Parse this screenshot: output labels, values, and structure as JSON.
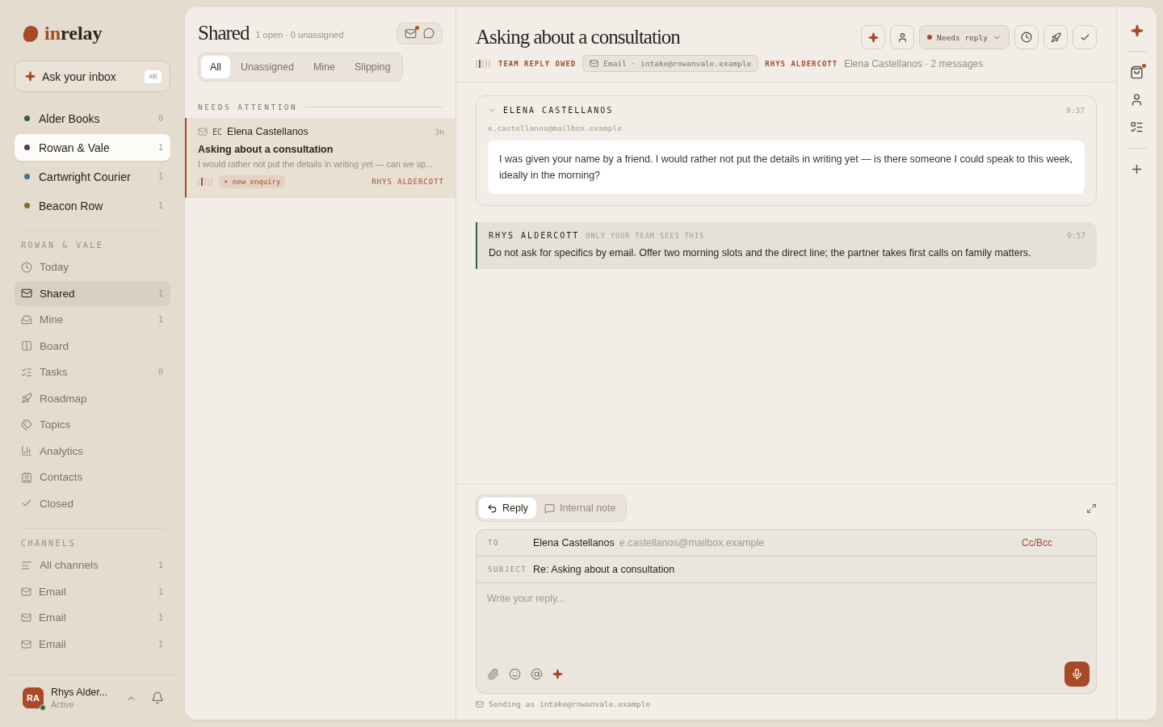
{
  "brand": {
    "accent": "in",
    "rest": "relay"
  },
  "ask": {
    "label": "Ask your inbox",
    "shortcut": "⌘K"
  },
  "workspaces": [
    {
      "name": "Alder Books",
      "count": "0",
      "color": "#3d5a44",
      "selected": false
    },
    {
      "name": "Rowan & Vale",
      "count": "1",
      "color": "#5b3a5a",
      "selected": true
    },
    {
      "name": "Cartwright Courier",
      "count": "1",
      "color": "#4a6f93",
      "selected": false
    },
    {
      "name": "Beacon Row",
      "count": "1",
      "color": "#8a6a2a",
      "selected": false
    }
  ],
  "nav_label": "ROWAN & VALE",
  "nav": [
    {
      "label": "Today",
      "selected": false
    },
    {
      "label": "Shared",
      "count": "1",
      "selected": true
    },
    {
      "label": "Mine",
      "count": "1",
      "selected": false
    },
    {
      "label": "Board",
      "selected": false
    },
    {
      "label": "Tasks",
      "count": "0",
      "selected": false
    },
    {
      "label": "Roadmap",
      "selected": false
    },
    {
      "label": "Topics",
      "selected": false
    },
    {
      "label": "Analytics",
      "selected": false
    },
    {
      "label": "Contacts",
      "selected": false
    },
    {
      "label": "Closed",
      "selected": false
    }
  ],
  "channels_label": "CHANNELS",
  "channels": [
    {
      "label": "All channels",
      "count": "1",
      "kind": "all"
    },
    {
      "label": "Email",
      "count": "1",
      "kind": "email"
    },
    {
      "label": "Email",
      "count": "1",
      "kind": "email"
    },
    {
      "label": "Email",
      "count": "1",
      "kind": "email"
    }
  ],
  "user": {
    "initials": "RA",
    "name": "Rhys Alder...",
    "status": "Active",
    "online": true
  },
  "list": {
    "title": "Shared",
    "summary": "1 open · 0 unassigned",
    "compose_unread": true,
    "filters": [
      {
        "label": "All",
        "selected": true
      },
      {
        "label": "Unassigned",
        "selected": false
      },
      {
        "label": "Mine",
        "selected": false
      },
      {
        "label": "Slipping",
        "selected": false
      }
    ],
    "group_label": "NEEDS ATTENTION",
    "conversations": [
      {
        "initials": "EC",
        "name": "Elena Castellanos",
        "time": "3h",
        "subject": "Asking about a consultation",
        "preview": "I would rather not put the details in writing yet — can we sp...",
        "tag": "• new enquiry",
        "assignee": "RHYS ALDERCOTT",
        "selected": true
      }
    ]
  },
  "conversation": {
    "title": "Asking about a consultation",
    "status_label": "TEAM REPLY OWED",
    "channel": "Email · intake@rowanvale.example",
    "assignee": "RHYS ALDERCOTT",
    "meta": "Elena Castellanos · 2 messages",
    "status_button": "Needs reply",
    "messages": [
      {
        "kind": "email",
        "sender": "ELENA CASTELLANOS",
        "time": "9:37",
        "address": "e.castellanos@mailbox.example",
        "body": "I was given your name by a friend. I would rather not put the details in writing yet — is there someone I could speak to this week, ideally in the morning?",
        "expanded": true
      },
      {
        "kind": "note",
        "sender": "RHYS ALDERCOTT",
        "visibility": "ONLY YOUR TEAM SEES THIS",
        "time": "9:57",
        "body": "Do not ask for specifics by email. Offer two morning slots and the direct line; the partner takes first calls on family matters."
      }
    ]
  },
  "composer": {
    "modes": [
      {
        "label": "Reply",
        "selected": true
      },
      {
        "label": "Internal note",
        "selected": false
      }
    ],
    "to_label": "TO",
    "to_name": "Elena Castellanos",
    "to_address": "e.castellanos@mailbox.example",
    "ccbcc": "Cc/Bcc",
    "subject_label": "SUBJECT",
    "subject": "Re: Asking about a consultation",
    "placeholder": "Write your reply...",
    "sending": "Sending as intake@rowanvale.example"
  },
  "rail": {
    "cart_unread": true
  }
}
